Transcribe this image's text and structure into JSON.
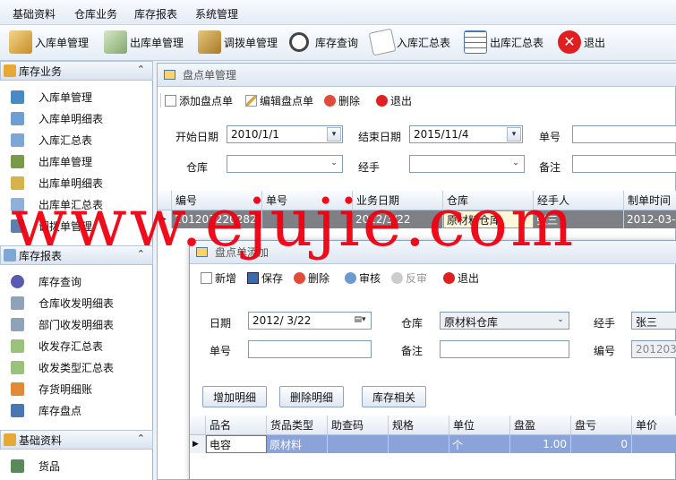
{
  "menu": [
    "基础资料",
    "仓库业务",
    "库存报表",
    "系统管理"
  ],
  "toolbar": [
    {
      "label": "入库单管理",
      "icon": "stock-in-icon"
    },
    {
      "label": "出库单管理",
      "icon": "stock-out-icon"
    },
    {
      "label": "调拨单管理",
      "icon": "transfer-icon"
    },
    {
      "label": "库存查询",
      "icon": "magnifier-icon"
    },
    {
      "label": "入库汇总表",
      "icon": "document-icon"
    },
    {
      "label": "出库汇总表",
      "icon": "grid-icon"
    },
    {
      "label": "退出",
      "icon": "exit-icon"
    }
  ],
  "sidebar": {
    "sections": [
      {
        "title": "库存业务",
        "items": [
          "入库单管理",
          "入库单明细表",
          "入库汇总表",
          "出库单管理",
          "出库单明细表",
          "出库单汇总表",
          "调拨单管理"
        ]
      },
      {
        "title": "库存报表",
        "items": [
          "库存查询",
          "仓库收发明细表",
          "部门收发明细表",
          "收发存汇总表",
          "收发类型汇总表",
          "存货明细账",
          "库存盘点"
        ]
      },
      {
        "title": "基础资料",
        "items": [
          "货品"
        ]
      }
    ]
  },
  "main": {
    "title": "盘点单管理",
    "actions": [
      "添加盘点单",
      "编辑盘点单",
      "删除",
      "退出"
    ],
    "filters": {
      "start_label": "开始日期",
      "start_value": "2010/1/1",
      "end_label": "结束日期",
      "end_value": "2015/11/4",
      "no_label": "单号",
      "no_value": "",
      "warehouse_label": "仓库",
      "warehouse_value": "",
      "handler_label": "经手",
      "handler_value": "",
      "remark_label": "备注",
      "remark_value": ""
    },
    "grid": {
      "columns": [
        "编号",
        "单号",
        "业务日期",
        "仓库",
        "经手人",
        "制单时间"
      ],
      "rows": [
        [
          "201203220282",
          "",
          "2012/3/22",
          "原材料仓库",
          "张三",
          "2012-03-"
        ]
      ]
    }
  },
  "dialog": {
    "title": "盘点单添加",
    "actions": [
      "新增",
      "保存",
      "删除",
      "审核",
      "反审",
      "退出"
    ],
    "form": {
      "date_label": "日期",
      "date_value": "2012/ 3/22",
      "warehouse_label": "仓库",
      "warehouse_value": "原材料仓库",
      "handler_label": "经手",
      "handler_value": "张三",
      "no_label": "单号",
      "no_value": "",
      "remark_label": "备注",
      "remark_value": "",
      "code_label": "编号",
      "code_value": "2012032"
    },
    "buttons": [
      "增加明细",
      "删除明细",
      "库存相关"
    ],
    "grid": {
      "columns": [
        "品名",
        "货品类型",
        "助查码",
        "规格",
        "单位",
        "盘盈",
        "盘亏",
        "单价"
      ],
      "rows": [
        [
          "电容",
          "原材料",
          "",
          "",
          "个",
          "1.00",
          "0",
          ""
        ]
      ]
    }
  },
  "watermark": "www.ejujie.com",
  "colors": {
    "accent": "#4a77b4",
    "watermark": "#f0000f",
    "selected_row": "#7f7f86",
    "dialog_row": "#8aa3d8"
  }
}
